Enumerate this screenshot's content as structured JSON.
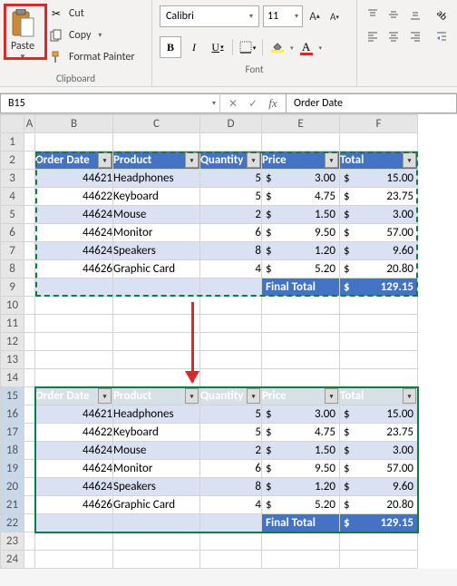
{
  "ribbon": {
    "clipboard": {
      "paste": "Paste",
      "cut": "Cut",
      "copy": "Copy",
      "format_painter": "Format Painter",
      "group_label": "Clipboard"
    },
    "font": {
      "name": "Calibri",
      "size": "11",
      "group_label": "Font"
    }
  },
  "namebox": "B15",
  "formula": "Order Date",
  "columns": [
    "A",
    "B",
    "C",
    "D",
    "E",
    "F"
  ],
  "rows": [
    "1",
    "2",
    "3",
    "4",
    "5",
    "6",
    "7",
    "8",
    "9",
    "10",
    "11",
    "12",
    "13",
    "14",
    "15",
    "16",
    "17",
    "18",
    "19",
    "20",
    "21",
    "22",
    "23",
    "24"
  ],
  "table": {
    "headers": [
      "Order Date",
      "Product",
      "Quantity",
      "Price",
      "Total"
    ],
    "rows": [
      {
        "date": "44621",
        "product": "Headphones",
        "qty": "5",
        "price": "3.00",
        "total": "15.00"
      },
      {
        "date": "44622",
        "product": "Keyboard",
        "qty": "5",
        "price": "4.75",
        "total": "23.75"
      },
      {
        "date": "44624",
        "product": "Mouse",
        "qty": "2",
        "price": "1.50",
        "total": "3.00"
      },
      {
        "date": "44624",
        "product": "Monitor",
        "qty": "6",
        "price": "9.50",
        "total": "57.00"
      },
      {
        "date": "44624",
        "product": "Speakers",
        "qty": "8",
        "price": "1.20",
        "total": "9.60"
      },
      {
        "date": "44626",
        "product": "Graphic Card",
        "qty": "4",
        "price": "5.20",
        "total": "20.80"
      }
    ],
    "final_label": "Final Total",
    "final_value": "129.15",
    "currency": "$"
  }
}
